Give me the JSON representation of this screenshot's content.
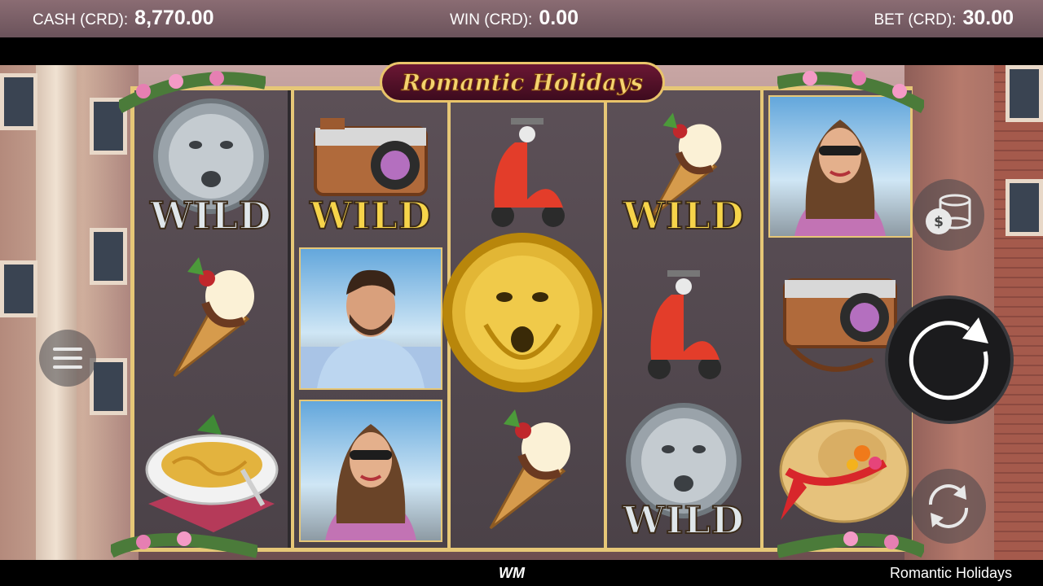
{
  "header": {
    "cash": {
      "label": "CASH (CRD):",
      "value": "8,770.00"
    },
    "win": {
      "label": "WIN (CRD):",
      "value": "0.00"
    },
    "bet": {
      "label": "BET (CRD):",
      "value": "30.00"
    }
  },
  "logo": {
    "text": "Romantic Holidays"
  },
  "reels": [
    [
      {
        "symbol": "silver-mask",
        "wild": "WILD"
      },
      {
        "symbol": "ice-cream-cone"
      },
      {
        "symbol": "pasta-bowl"
      }
    ],
    [
      {
        "symbol": "vintage-camera",
        "wild": "WILD"
      },
      {
        "symbol": "man-portrait"
      },
      {
        "symbol": "woman-portrait"
      }
    ],
    [
      {
        "symbol": "red-scooter"
      },
      {
        "symbol": "gold-mask"
      },
      {
        "symbol": "ice-cream-cone"
      }
    ],
    [
      {
        "symbol": "ice-cream-cone",
        "wild": "WILD"
      },
      {
        "symbol": "red-scooter"
      },
      {
        "symbol": "silver-mask",
        "wild": "WILD"
      }
    ],
    [
      {
        "symbol": "woman-portrait"
      },
      {
        "symbol": "vintage-camera"
      },
      {
        "symbol": "sun-hat"
      }
    ]
  ],
  "controls": {
    "menu": "hamburger-menu-icon",
    "coins": "coin-stack-icon",
    "spin": "spin-arrow-icon",
    "autoplay": "autoplay-icon"
  },
  "footer": {
    "brand": "WM",
    "game_name": "Romantic Holidays"
  },
  "colors": {
    "frame_gold": "#e6c777",
    "header_bg": "#7a5f67",
    "wild_gold": "#f6d44a",
    "wild_silver": "#dfe6ea"
  }
}
